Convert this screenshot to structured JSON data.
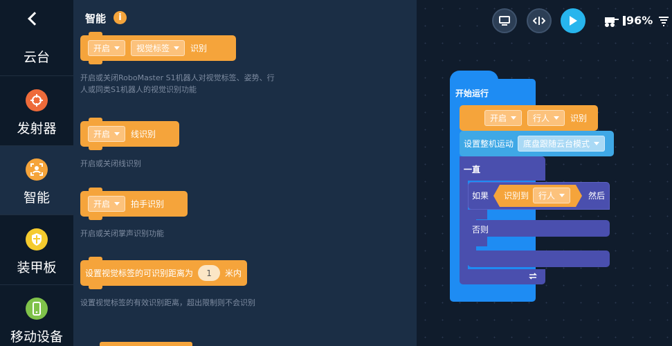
{
  "sidebar": {
    "back_label": "云台",
    "items": [
      {
        "label": "发射器",
        "icon": "crosshair-icon",
        "color": "#ee6b3a"
      },
      {
        "label": "智能",
        "icon": "vision-scan-icon",
        "color": "#f5a43b"
      },
      {
        "label": "装甲板",
        "icon": "armor-shield-icon",
        "color": "#f5cb2e"
      },
      {
        "label": "移动设备",
        "icon": "mobile-device-icon",
        "color": "#7fc24a"
      }
    ]
  },
  "palette": {
    "title": "智能",
    "info_glyph": "i",
    "blocks": [
      {
        "toggle": "开启",
        "dropdown": "视觉标签",
        "suffix": "识别",
        "desc": "开启或关闭RoboMaster S1机器人对视觉标签、姿势、行人或同类S1机器人的视觉识别功能"
      },
      {
        "toggle": "开启",
        "suffix": "线识别",
        "desc": "开启或关闭线识别"
      },
      {
        "toggle": "开启",
        "suffix": "拍手识别",
        "desc": "开启或关闭掌声识别功能"
      },
      {
        "prefix": "设置视觉标签的可识别距离为",
        "value": "1",
        "suffix": "米内",
        "desc": "设置视觉标签的有效识别距离，超出限制则不会识别"
      }
    ]
  },
  "toolbar": {
    "battery": "96%"
  },
  "program": {
    "start_label": "开始运行",
    "vision_toggle": "开启",
    "vision_target": "行人",
    "vision_suffix": "识别",
    "chassis_label": "设置整机运动",
    "chassis_mode": "底盘跟随云台模式",
    "forever_label": "一直",
    "if_label": "如果",
    "cond_label": "识别到",
    "cond_target": "行人",
    "then_label": "然后",
    "else_label": "否则",
    "repeat_icon": "repeat-icon"
  },
  "colors": {
    "event_blue": "#1e8cf3",
    "smart_orange": "#f5a43b",
    "chassis_lightblue": "#3fa8e6",
    "loop_indigo": "#4a4fae",
    "condition_green": "#37b07a",
    "play_cyan": "#27b5ed"
  }
}
